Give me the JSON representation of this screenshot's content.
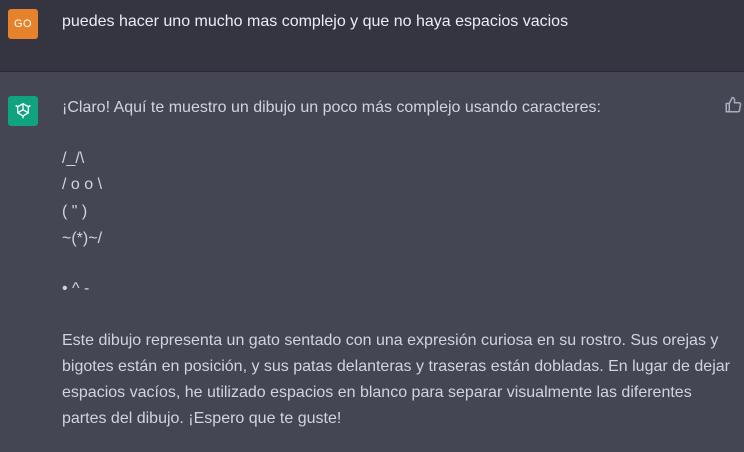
{
  "user_message": {
    "avatar_initials": "GO",
    "avatar_color": "#e5822b",
    "text": "puedes hacer uno mucho mas complejo y que no haya espacios vacios"
  },
  "assistant_message": {
    "avatar_icon": "openai-logo-icon",
    "avatar_color": "#10a37f",
    "intro": "¡Claro! Aquí te muestro un dibujo un poco más complejo usando caracteres:",
    "art_lines": [
      "/_/\\",
      "/ o o \\",
      "( \" )",
      "~(*)~/",
      "•  ^ -"
    ],
    "paragraph_lines": [
      "Este dibujo representa un gato sentado con una expresión curiosa en su rostro. Sus orejas y",
      "bigotes están en posición, y sus patas delanteras y traseras están dobladas. En lugar de dejar",
      "espacios vacíos, he utilizado espacios en blanco para separar visualmente las diferentes",
      "partes del dibujo. ¡Espero que te guste!"
    ],
    "feedback_icon": "thumbs-up-icon"
  }
}
